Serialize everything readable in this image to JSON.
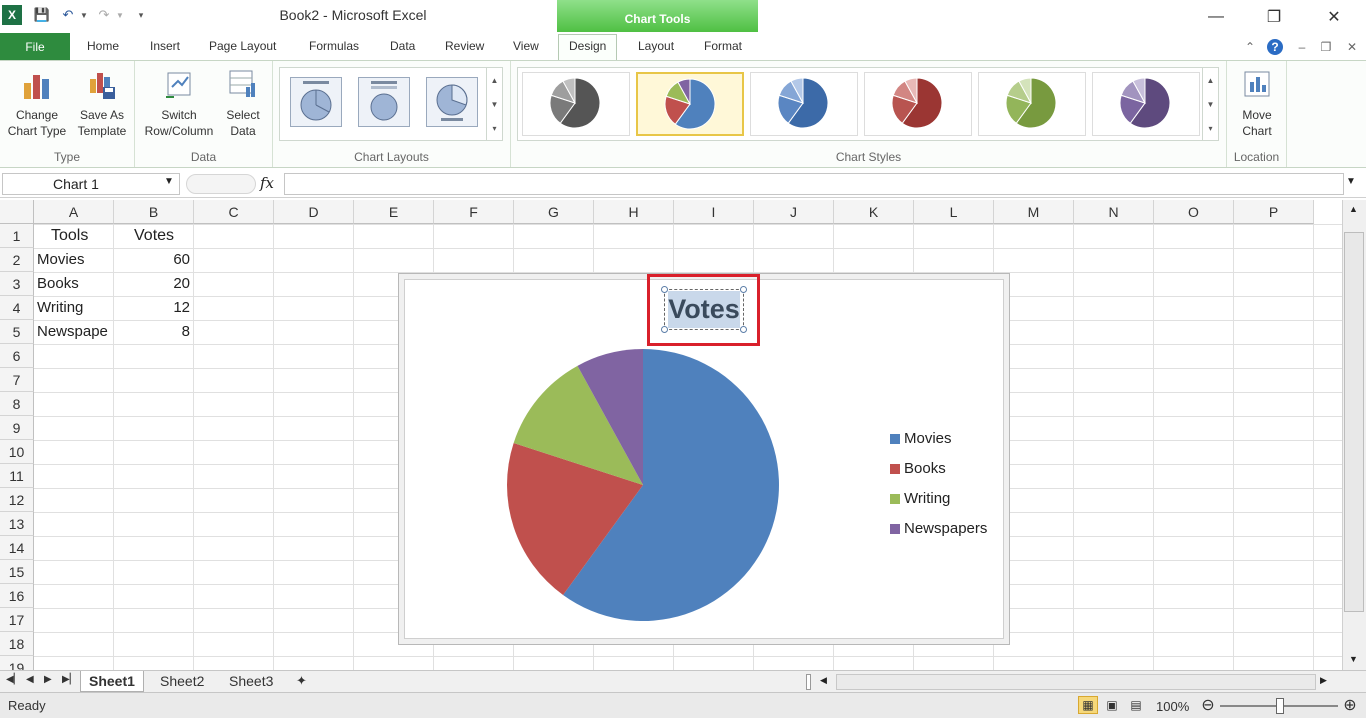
{
  "window": {
    "title": "Book2  -  Microsoft Excel",
    "contextual_tab": "Chart Tools"
  },
  "tabs": [
    "File",
    "Home",
    "Insert",
    "Page Layout",
    "Formulas",
    "Data",
    "Review",
    "View",
    "Design",
    "Layout",
    "Format"
  ],
  "active_tab": "Design",
  "ribbon": {
    "type_group": {
      "label": "Type",
      "change_chart_type": "Change\nChart Type",
      "save_as_template": "Save As\nTemplate"
    },
    "data_group": {
      "label": "Data",
      "switch_row_column": "Switch\nRow/Column",
      "select_data": "Select\nData"
    },
    "layouts_group": {
      "label": "Chart Layouts"
    },
    "styles_group": {
      "label": "Chart Styles",
      "styles": [
        {
          "colors": [
            "#555555",
            "#7a7a7a",
            "#9e9e9e",
            "#c0c0c0"
          ]
        },
        {
          "colors": [
            "#4f81bd",
            "#c0504d",
            "#9bbb59",
            "#8064a2"
          ]
        },
        {
          "colors": [
            "#3c6aa8",
            "#5a86c2",
            "#85a6d6",
            "#b3c8e8"
          ]
        },
        {
          "colors": [
            "#9b3633",
            "#b85450",
            "#d28683",
            "#e8b9b7"
          ]
        },
        {
          "colors": [
            "#789a3f",
            "#93b55a",
            "#b5cd8b",
            "#d4e3bb"
          ]
        },
        {
          "colors": [
            "#5e4a7e",
            "#7b65a0",
            "#a294bf",
            "#c8bfdb"
          ]
        }
      ],
      "selected_index": 1
    },
    "location_group": {
      "label": "Location",
      "move_chart": "Move\nChart"
    }
  },
  "formula_bar": {
    "name_box": "Chart 1",
    "fx": "fx",
    "formula": ""
  },
  "columns": [
    "A",
    "B",
    "C",
    "D",
    "E",
    "F",
    "G",
    "H",
    "I",
    "J",
    "K",
    "L",
    "M",
    "N",
    "O",
    "P"
  ],
  "rows": [
    "1",
    "2",
    "3",
    "4",
    "5",
    "6",
    "7",
    "8",
    "9",
    "10",
    "11",
    "12",
    "13",
    "14",
    "15",
    "16",
    "17",
    "18",
    "19"
  ],
  "cells": {
    "A1": "Tools",
    "B1": "Votes",
    "A2": "Movies",
    "B2": "60",
    "A3": "Books",
    "B3": "20",
    "A4": "Writing",
    "B4": "12",
    "A5": "Newspape",
    "B5": "8"
  },
  "chart_data": {
    "type": "pie",
    "title": "Votes",
    "categories": [
      "Movies",
      "Books",
      "Writing",
      "Newspapers"
    ],
    "values": [
      60,
      20,
      12,
      8
    ],
    "colors": [
      "#4f81bd",
      "#c0504d",
      "#9bbb59",
      "#8064a2"
    ],
    "legend_position": "right"
  },
  "sheets": [
    "Sheet1",
    "Sheet2",
    "Sheet3"
  ],
  "active_sheet": "Sheet1",
  "status": {
    "ready": "Ready",
    "zoom": "100%"
  }
}
